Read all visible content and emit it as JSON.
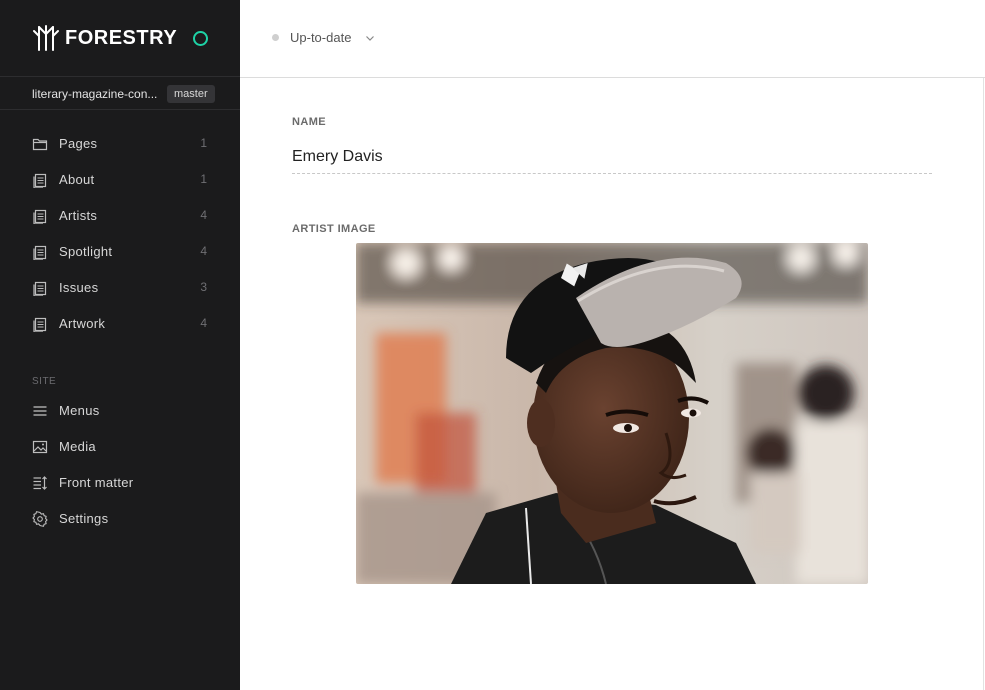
{
  "brand": {
    "name": "FORESTRY",
    "accent": "#1ed3a6"
  },
  "repo": {
    "name": "literary-magazine-con...",
    "branch": "master"
  },
  "nav": {
    "content": [
      {
        "label": "Pages",
        "count": "1",
        "icon": "folder-icon"
      },
      {
        "label": "About",
        "count": "1",
        "icon": "document-icon"
      },
      {
        "label": "Artists",
        "count": "4",
        "icon": "document-icon"
      },
      {
        "label": "Spotlight",
        "count": "4",
        "icon": "document-icon"
      },
      {
        "label": "Issues",
        "count": "3",
        "icon": "document-icon"
      },
      {
        "label": "Artwork",
        "count": "4",
        "icon": "document-icon"
      }
    ],
    "site_label": "SITE",
    "site": [
      {
        "label": "Menus",
        "icon": "menu-icon"
      },
      {
        "label": "Media",
        "icon": "image-icon"
      },
      {
        "label": "Front matter",
        "icon": "front-matter-icon"
      },
      {
        "label": "Settings",
        "icon": "gear-icon"
      }
    ]
  },
  "topbar": {
    "status": "Up-to-date"
  },
  "form": {
    "name_label": "NAME",
    "name_value": "Emery Davis",
    "image_label": "ARTIST IMAGE",
    "image_alt": "artist-photo"
  },
  "colors": {
    "sidebar_bg": "#1b1b1c",
    "accent": "#1ed3a6"
  }
}
